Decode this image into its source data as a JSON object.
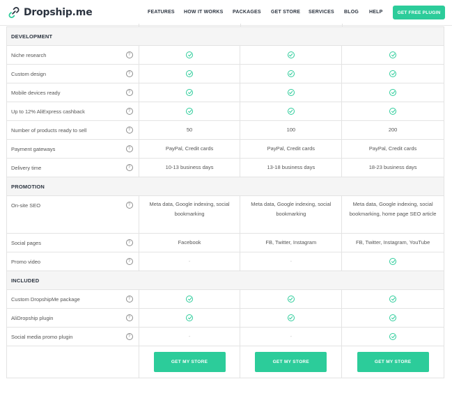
{
  "brand": {
    "name": "Dropship.me",
    "accent": "#2ccc9a"
  },
  "nav": {
    "items": [
      "FEATURES",
      "HOW IT WORKS",
      "PACKAGES",
      "GET STORE",
      "SERVICES",
      "BLOG",
      "HELP"
    ],
    "cta": "GET FREE PLUGIN"
  },
  "table": {
    "sections": [
      {
        "title": "DEVELOPMENT",
        "rows": [
          {
            "label": "Niche research",
            "values": [
              "check",
              "check",
              "check"
            ]
          },
          {
            "label": "Custom design",
            "values": [
              "check",
              "check",
              "check"
            ]
          },
          {
            "label": "Mobile devices ready",
            "values": [
              "check",
              "check",
              "check"
            ]
          },
          {
            "label": "Up to 12% AliExpress cashback",
            "values": [
              "check",
              "check",
              "check"
            ]
          },
          {
            "label": "Number of products ready to sell",
            "values": [
              "50",
              "100",
              "200"
            ]
          },
          {
            "label": "Payment gateways",
            "values": [
              "PayPal, Credit cards",
              "PayPal, Credit cards",
              "PayPal, Credit cards"
            ]
          },
          {
            "label": "Delivery time",
            "values": [
              "10-13 business days",
              "13-18 business days",
              "18-23 business days"
            ]
          }
        ]
      },
      {
        "title": "PROMOTION",
        "rows": [
          {
            "label": "On-site SEO",
            "values": [
              "Meta data, Google indexing, social bookmarking",
              "Meta data, Google indexing, social bookmarking",
              "Meta data, Google indexing, social bookmarking, home page SEO article"
            ]
          },
          {
            "label": "Social pages",
            "values": [
              "Facebook",
              "FB, Twitter, Instagram",
              "FB, Twitter, Instagram, YouTube"
            ]
          },
          {
            "label": "Promo video",
            "values": [
              "-",
              "-",
              "check"
            ]
          }
        ]
      },
      {
        "title": "INCLUDED",
        "rows": [
          {
            "label": "Custom DropshipMe package",
            "values": [
              "check",
              "check",
              "check"
            ]
          },
          {
            "label": "AliDropship plugin",
            "values": [
              "check",
              "check",
              "check"
            ]
          },
          {
            "label": "Social media promo plugin",
            "values": [
              "-",
              "-",
              "check"
            ]
          }
        ]
      }
    ],
    "button_label": "GET MY STORE",
    "info_glyph": "?"
  }
}
